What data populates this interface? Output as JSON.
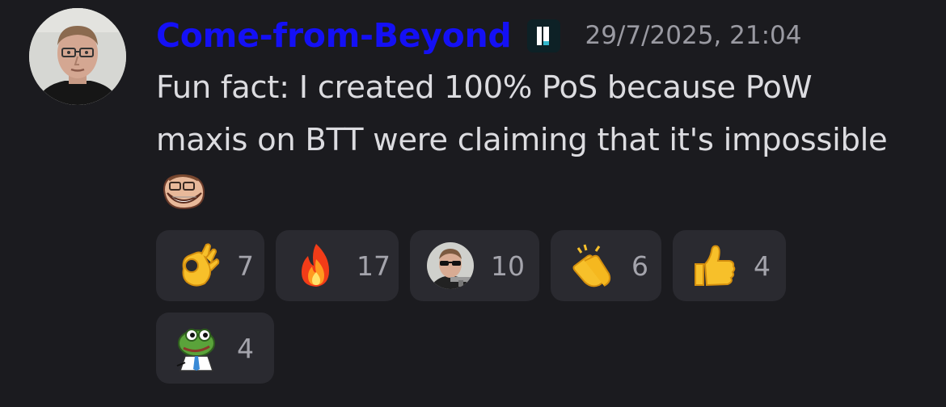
{
  "message": {
    "author": "Come-from-Beyond",
    "author_color": "#1410f5",
    "role_badge_icon": "role-badge-icon",
    "timestamp": "29/7/2025, 21:04",
    "text": "Fun fact: I created 100% PoS because PoW maxis on BTT were claiming that it's impossible",
    "inline_emoji": "trollface-emoji"
  },
  "reactions": [
    {
      "emoji": "ok-hand-emoji",
      "count": "7"
    },
    {
      "emoji": "fire-emoji",
      "count": "17"
    },
    {
      "emoji": "custom-sunglasses-face-emoji",
      "count": "10"
    },
    {
      "emoji": "clapping-hands-emoji",
      "count": "6"
    },
    {
      "emoji": "thumbs-up-emoji",
      "count": "4"
    },
    {
      "emoji": "custom-pepe-frog-emoji",
      "count": "4"
    }
  ]
}
